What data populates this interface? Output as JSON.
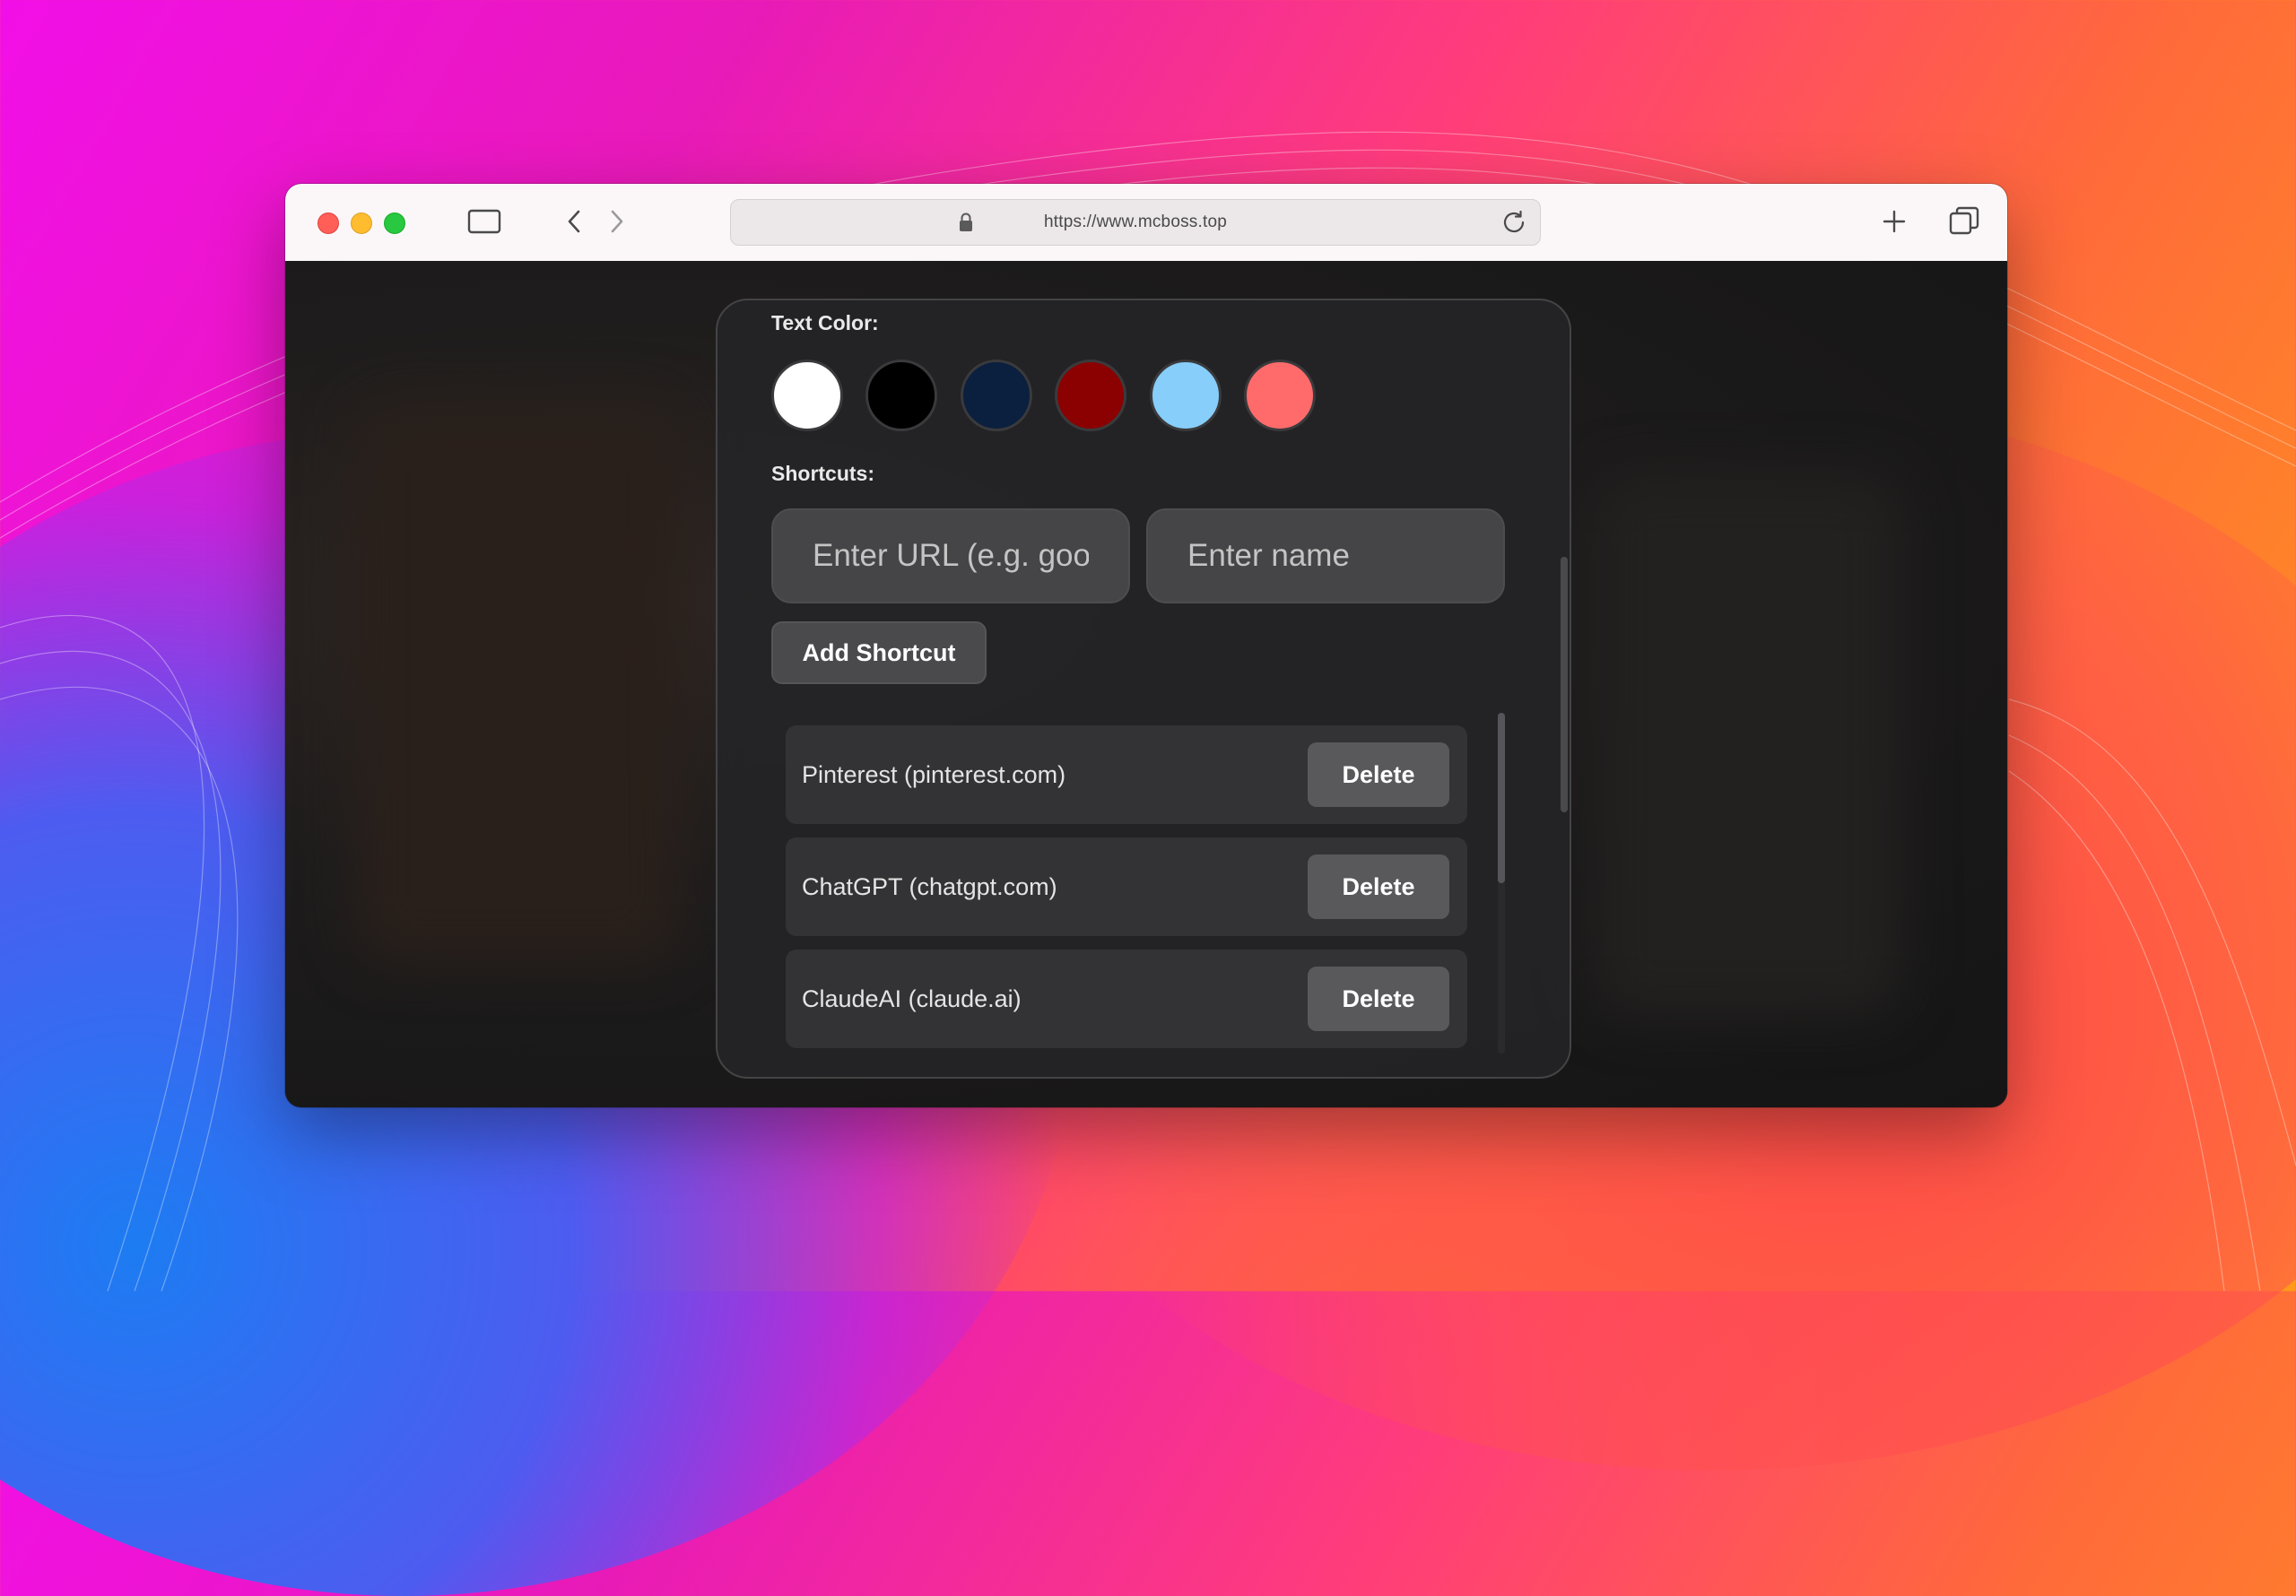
{
  "browser": {
    "url": "https://www.mcboss.top"
  },
  "panel": {
    "text_color_label": "Text Color:",
    "colors": [
      "#ffffff",
      "#000000",
      "#0b1f3f",
      "#8b0000",
      "#87cefa",
      "#ff6b6b"
    ],
    "shortcuts_label": "Shortcuts:",
    "url_placeholder": "Enter URL (e.g. google.com)",
    "name_placeholder": "Enter name",
    "add_button": "Add Shortcut",
    "delete_label": "Delete",
    "shortcuts": [
      {
        "label": "Pinterest (pinterest.com)"
      },
      {
        "label": "ChatGPT (chatgpt.com)"
      },
      {
        "label": "ClaudeAI (claude.ai)"
      }
    ]
  }
}
